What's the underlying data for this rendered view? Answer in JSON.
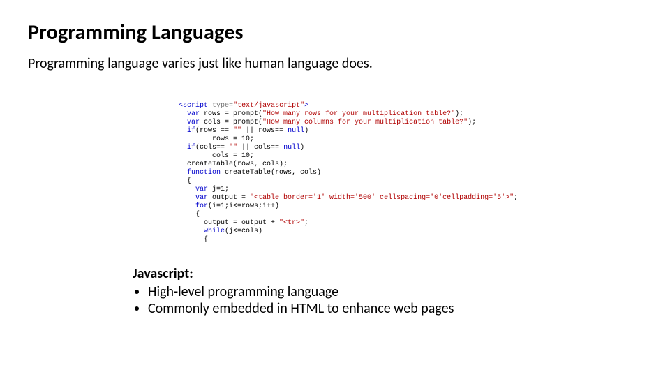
{
  "title": "Programming Languages",
  "subtitle": "Programming language varies just like human language does.",
  "code": {
    "l01a": "<",
    "l01b": "script",
    "l01c": " type",
    "l01d": "=",
    "l01e": "\"text/javascript\"",
    "l01f": ">",
    "l02a": "  var",
    "l02b": " rows = prompt(",
    "l02c": "\"How many rows for your multiplication table?\"",
    "l02d": ");",
    "l03a": "  var",
    "l03b": " cols = prompt(",
    "l03c": "\"How many columns for your multiplication table?\"",
    "l03d": ");",
    "l04a": "  if",
    "l04b": "(rows == ",
    "l04c": "\"\"",
    "l04d": " || rows== ",
    "l04e": "null",
    "l04f": ")",
    "l05": "        rows = 10;",
    "l06a": "  if",
    "l06b": "(cols== ",
    "l06c": "\"\"",
    "l06d": " || cols== ",
    "l06e": "null",
    "l06f": ")",
    "l07": "        cols = 10;",
    "l08": "  createTable(rows, cols);",
    "l09a": "  function",
    "l09b": " createTable(rows, cols)",
    "l10": "  {",
    "l11a": "    var",
    "l11b": " j=1;",
    "l12a": "    var",
    "l12b": " output = ",
    "l12c": "\"<table border='1' width='500' cellspacing='0'cellpadding='5'>\"",
    "l12d": ";",
    "l13a": "    for",
    "l13b": "(i=1;i<=rows;i++)",
    "l14": "    {",
    "l15a": "      output = output + ",
    "l15b": "\"<tr>\"",
    "l15c": ";",
    "l16a": "      while",
    "l16b": "(j<=cols)",
    "l17": "      {"
  },
  "desc": {
    "lead": "Javascript:",
    "bullets": [
      "High-level programming language",
      "Commonly embedded in HTML to enhance web pages"
    ]
  }
}
